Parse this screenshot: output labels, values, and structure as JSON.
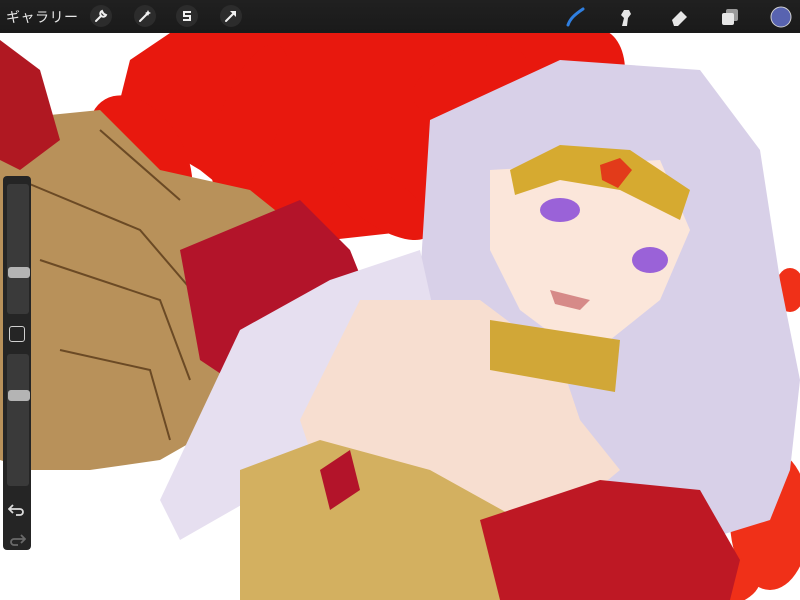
{
  "topbar": {
    "gallery_label": "ギャラリー",
    "left_tools": [
      "wrench-icon",
      "magic-wand-icon",
      "selection-s-icon",
      "arrow-transform-icon"
    ],
    "right_tools": [
      "brush-icon",
      "smudge-icon",
      "eraser-icon",
      "layers-icon",
      "color-swatch-icon"
    ],
    "active_tool": "brush-icon",
    "colors": {
      "bar": "#1c1c1c",
      "accent": "#2f7fe0",
      "current_color": "#5863b0"
    }
  },
  "sidebar": {
    "brush_size": 0.3,
    "opacity": 0.7,
    "icons": [
      "modify-square-icon",
      "undo-icon",
      "redo-icon"
    ]
  }
}
